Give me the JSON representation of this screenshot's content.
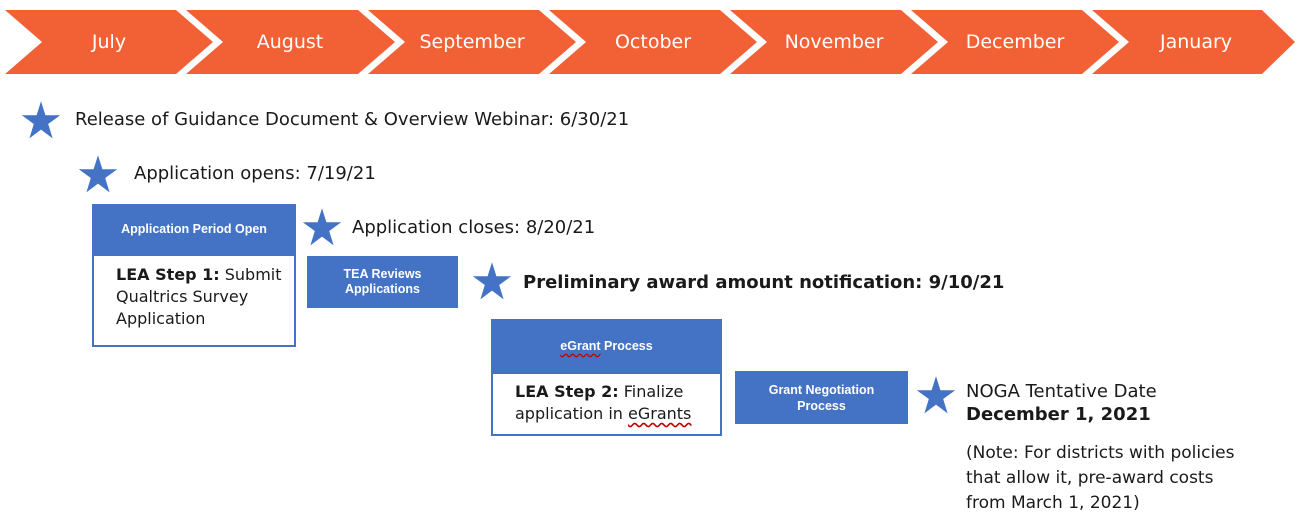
{
  "timeline": {
    "color": "#f26135",
    "months": [
      "July",
      "August",
      "September",
      "October",
      "November",
      "December",
      "January"
    ]
  },
  "milestones": {
    "guidance": "Release of Guidance Document & Overview Webinar: 6/30/21",
    "opens": "Application opens: 7/19/21",
    "closes": "Application closes: 8/20/21",
    "preliminary": "Preliminary award amount notification: 9/10/21"
  },
  "boxes": {
    "app_period": {
      "header": "Application Period Open",
      "step_label": "LEA Step 1:",
      "step_text_1": " Submit",
      "step_text_2": "Qualtrics Survey",
      "step_text_3": "Application"
    },
    "tea_reviews": {
      "line1": "TEA Reviews",
      "line2": "Applications"
    },
    "egrant": {
      "header_word": "eGrant",
      "header_rest": " Process",
      "step_label": "LEA Step 2:",
      "step_text_1": " Finalize",
      "step_text_2": "application in ",
      "step_text_3": "eGrants"
    },
    "grant_negotiation": {
      "line1": "Grant Negotiation",
      "line2": "Process"
    }
  },
  "noga": {
    "title": "NOGA Tentative Date",
    "date": "December 1, 2021",
    "note_1": "(Note: For districts with policies",
    "note_2": "that allow it, pre-award costs",
    "note_3": "from March 1, 2021)"
  },
  "colors": {
    "star": "#4472c4",
    "box": "#4472c4",
    "arrow": "#f26135",
    "spellcheck": "#c00000"
  },
  "icons": {
    "milestone": "star-icon"
  }
}
